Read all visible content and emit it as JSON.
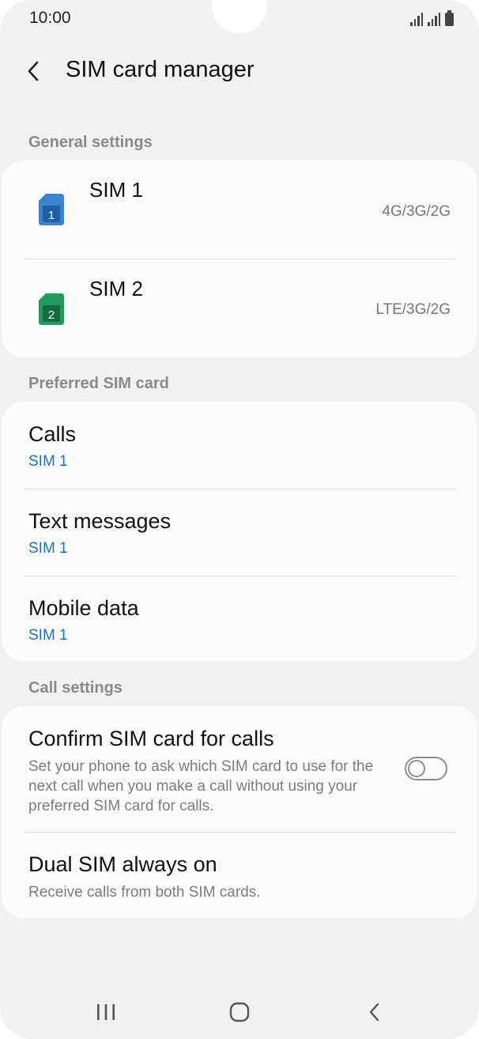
{
  "status_bar": {
    "time": "10:00"
  },
  "header": {
    "back_icon": "chevron-left-icon",
    "title": "SIM card manager"
  },
  "general_settings": {
    "label": "General settings",
    "sims": [
      {
        "name": "SIM 1",
        "network": "4G/3G/2G",
        "icon_number": "1",
        "color": "#3b82cf"
      },
      {
        "name": "SIM 2",
        "network": "LTE/3G/2G",
        "icon_number": "2",
        "color": "#1f9c5e"
      }
    ]
  },
  "preferred_sim": {
    "label": "Preferred SIM card",
    "items": [
      {
        "title": "Calls",
        "value": "SIM 1"
      },
      {
        "title": "Text messages",
        "value": "SIM 1"
      },
      {
        "title": "Mobile data",
        "value": "SIM 1"
      }
    ]
  },
  "call_settings": {
    "label": "Call settings",
    "confirm": {
      "title": "Confirm SIM card for calls",
      "description": "Set your phone to ask which SIM card to use for the next call when you make a call without using your preferred SIM card for calls.",
      "enabled": false
    },
    "dual_sim": {
      "title": "Dual SIM always on",
      "description": "Receive calls from both SIM cards."
    }
  },
  "colors": {
    "accent": "#1a73c8",
    "background": "#f1f1f1",
    "card": "#fbfbfb"
  }
}
